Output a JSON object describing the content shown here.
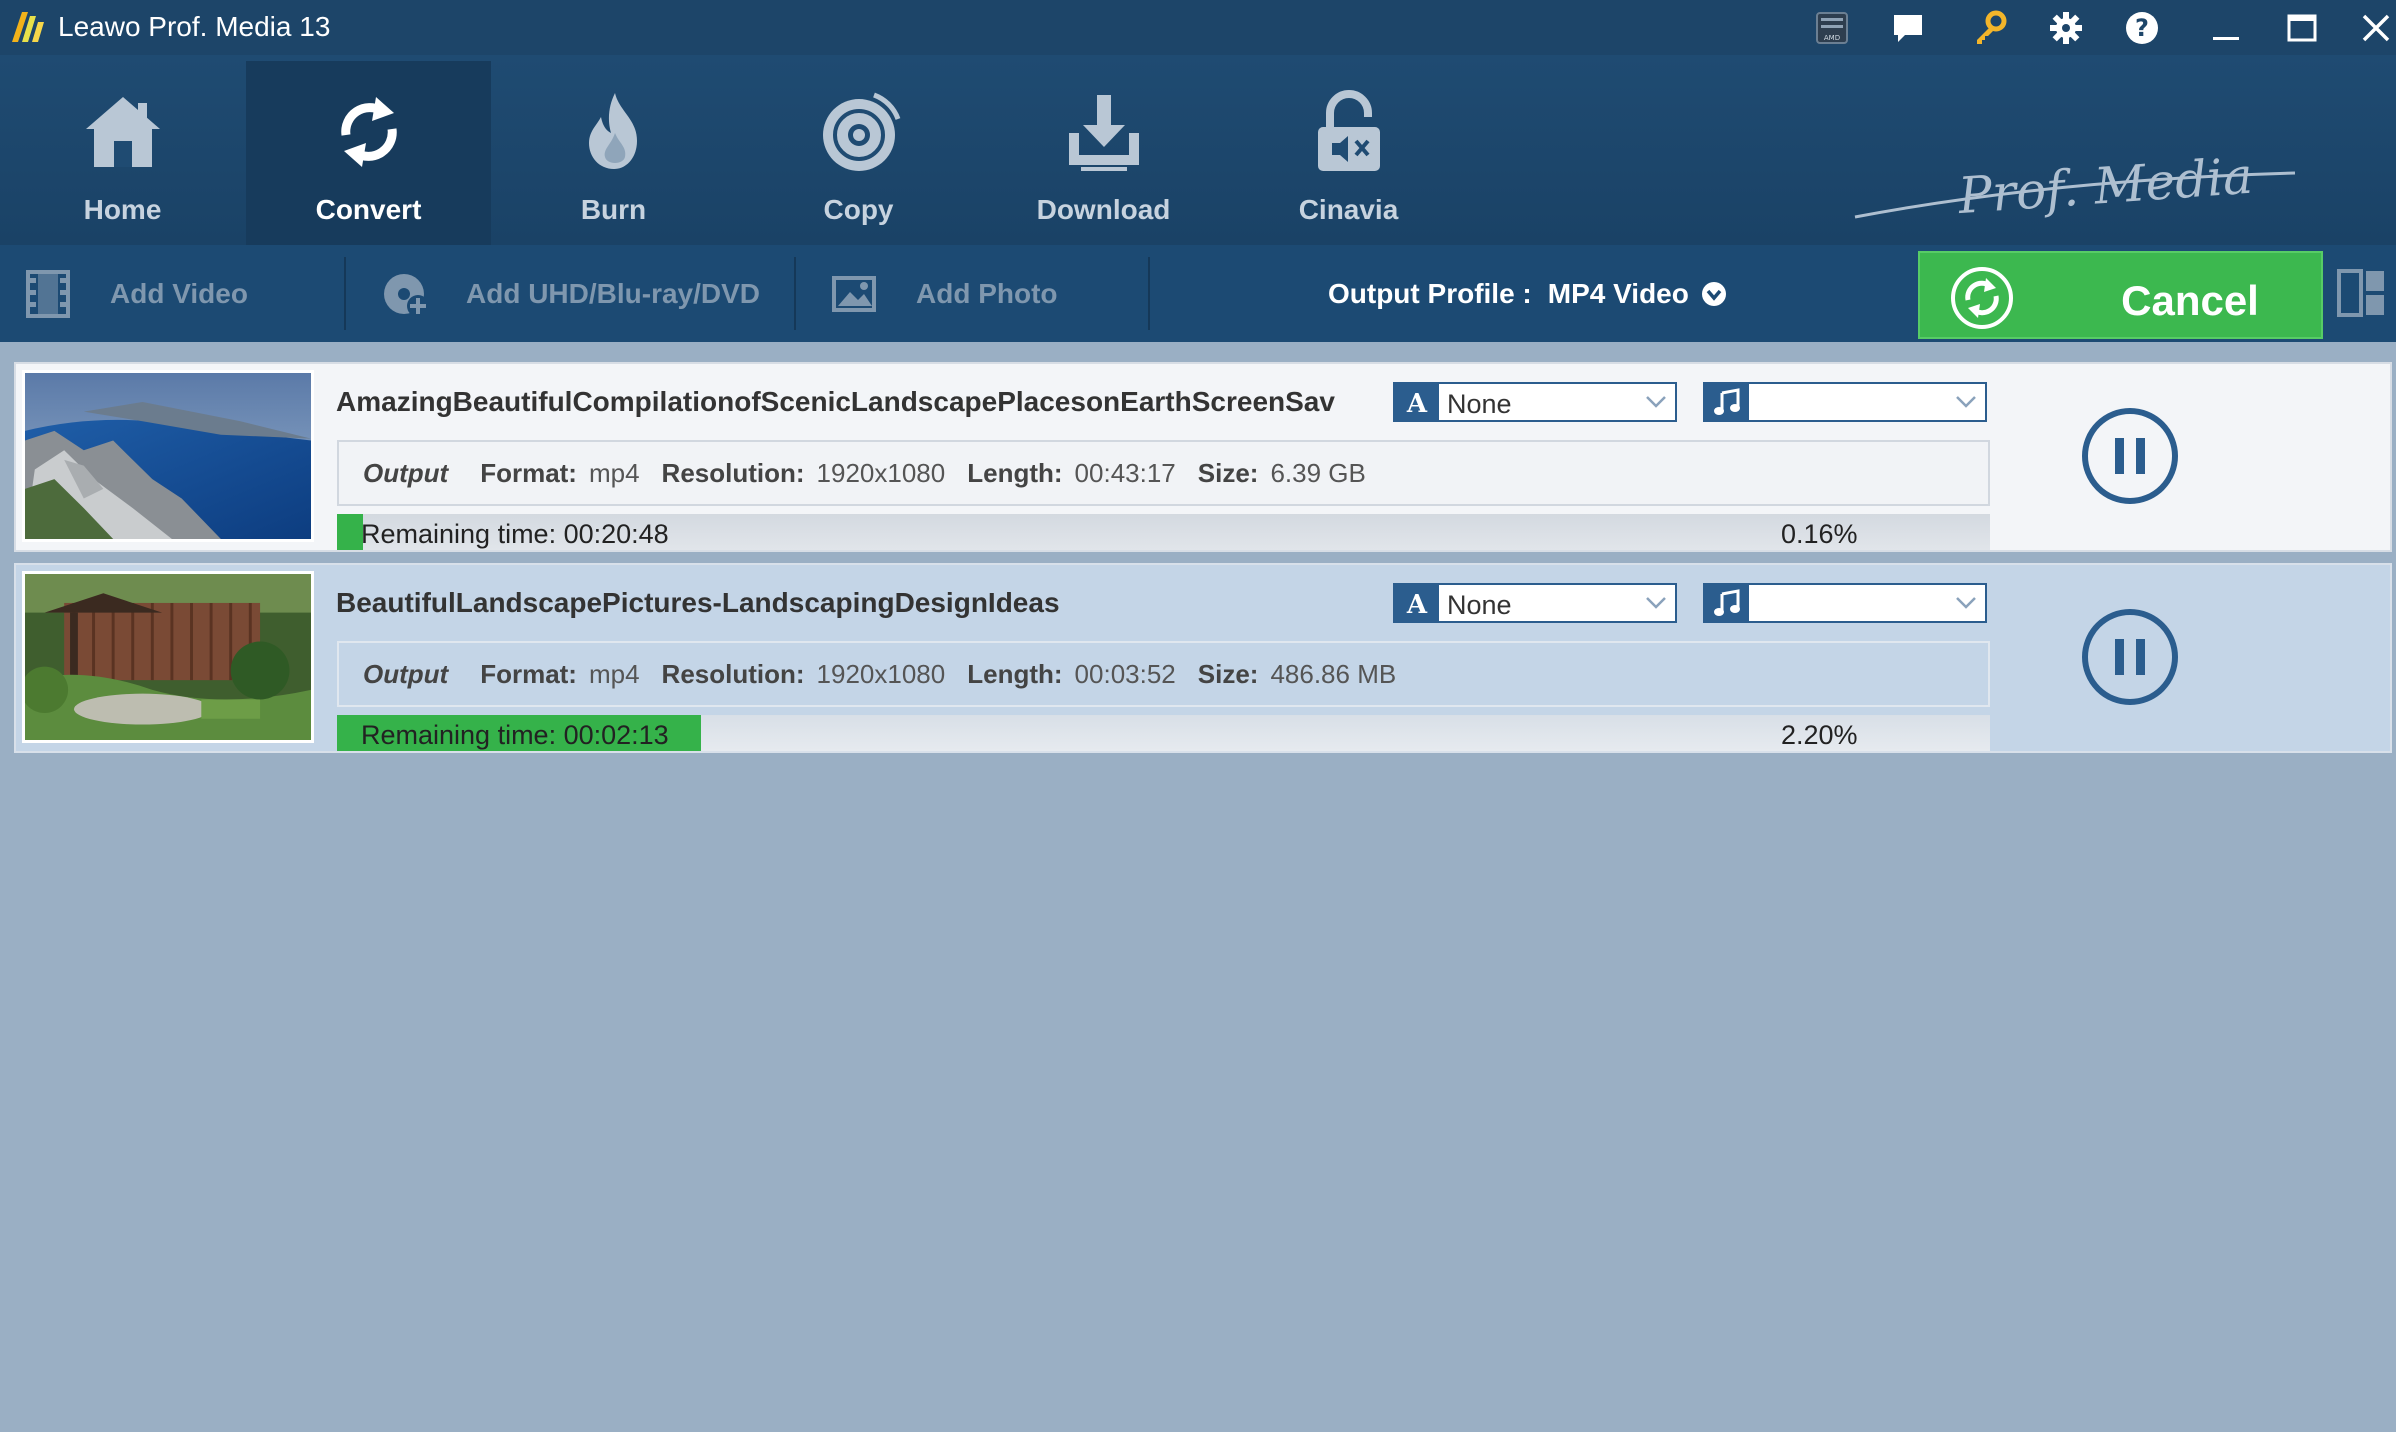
{
  "titlebar": {
    "title": "Leawo Prof. Media 13",
    "icons": [
      "amd-badge-icon",
      "feedback-icon",
      "key-icon",
      "gear-icon",
      "help-icon",
      "minimize-icon",
      "maximize-icon",
      "close-icon"
    ]
  },
  "nav": {
    "tabs": [
      {
        "label": "Home",
        "icon": "home-icon"
      },
      {
        "label": "Convert",
        "icon": "convert-icon",
        "active": true
      },
      {
        "label": "Burn",
        "icon": "flame-icon"
      },
      {
        "label": "Copy",
        "icon": "disc-icon"
      },
      {
        "label": "Download",
        "icon": "download-icon"
      },
      {
        "label": "Cinavia",
        "icon": "unlock-icon"
      }
    ],
    "brand": "Prof. Media"
  },
  "toolbar": {
    "add_video": "Add Video",
    "add_disc": "Add UHD/Blu-ray/DVD",
    "add_photo": "Add Photo",
    "output_profile_label": "Output Profile :",
    "output_profile_value": "MP4 Video",
    "cancel": "Cancel"
  },
  "tasks": [
    {
      "title": "AmazingBeautifulCompilationofScenicLandscapePlacesonEarthScreenSav",
      "subtitle_value": "None",
      "audio_value": "",
      "output_label": "Output",
      "format_label": "Format:",
      "format": "mp4",
      "resolution_label": "Resolution:",
      "resolution": "1920x1080",
      "length_label": "Length:",
      "length": "00:43:17",
      "size_label": "Size:",
      "size": "6.39 GB",
      "remaining": "Remaining time: 00:20:48",
      "percent": "0.16%",
      "progress": 0.0016
    },
    {
      "title": "BeautifulLandscapePictures-LandscapingDesignIdeas",
      "subtitle_value": "None",
      "audio_value": "",
      "output_label": "Output",
      "format_label": "Format:",
      "format": "mp4",
      "resolution_label": "Resolution:",
      "resolution": "1920x1080",
      "length_label": "Length:",
      "length": "00:03:52",
      "size_label": "Size:",
      "size": "486.86 MB",
      "remaining": "Remaining time: 00:02:13",
      "percent": "2.20%",
      "progress": 0.022
    }
  ],
  "colors": {
    "titlebar": "#1d4569",
    "toolbar": "#1f4b72",
    "accent_green": "#3cb84f",
    "background": "#9aafc4",
    "selected_row": "#c4d5e7"
  }
}
